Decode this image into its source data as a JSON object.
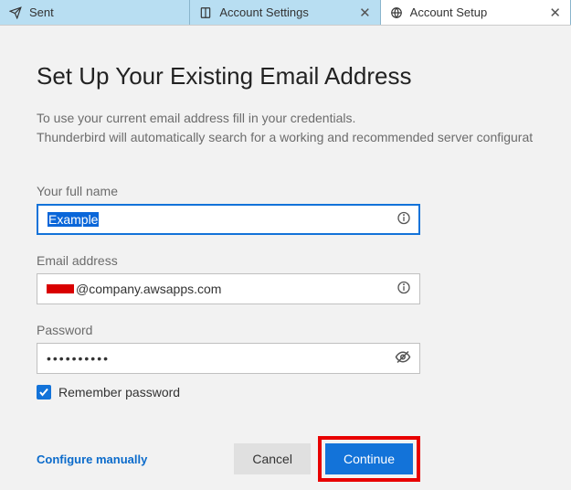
{
  "tabs": {
    "sent": "Sent",
    "account_settings": "Account Settings",
    "account_setup": "Account Setup"
  },
  "heading": "Set Up Your Existing Email Address",
  "description": {
    "line1": "To use your current email address fill in your credentials.",
    "line2": "Thunderbird will automatically search for a working and recommended server configurat"
  },
  "form": {
    "name_label": "Your full name",
    "name_value": "Example",
    "email_label": "Email address",
    "email_value_suffix": "@company.awsapps.com",
    "password_label": "Password",
    "password_value": "••••••••••",
    "remember_label": "Remember password",
    "remember_checked": true
  },
  "actions": {
    "configure": "Configure manually",
    "cancel": "Cancel",
    "continue": "Continue"
  }
}
